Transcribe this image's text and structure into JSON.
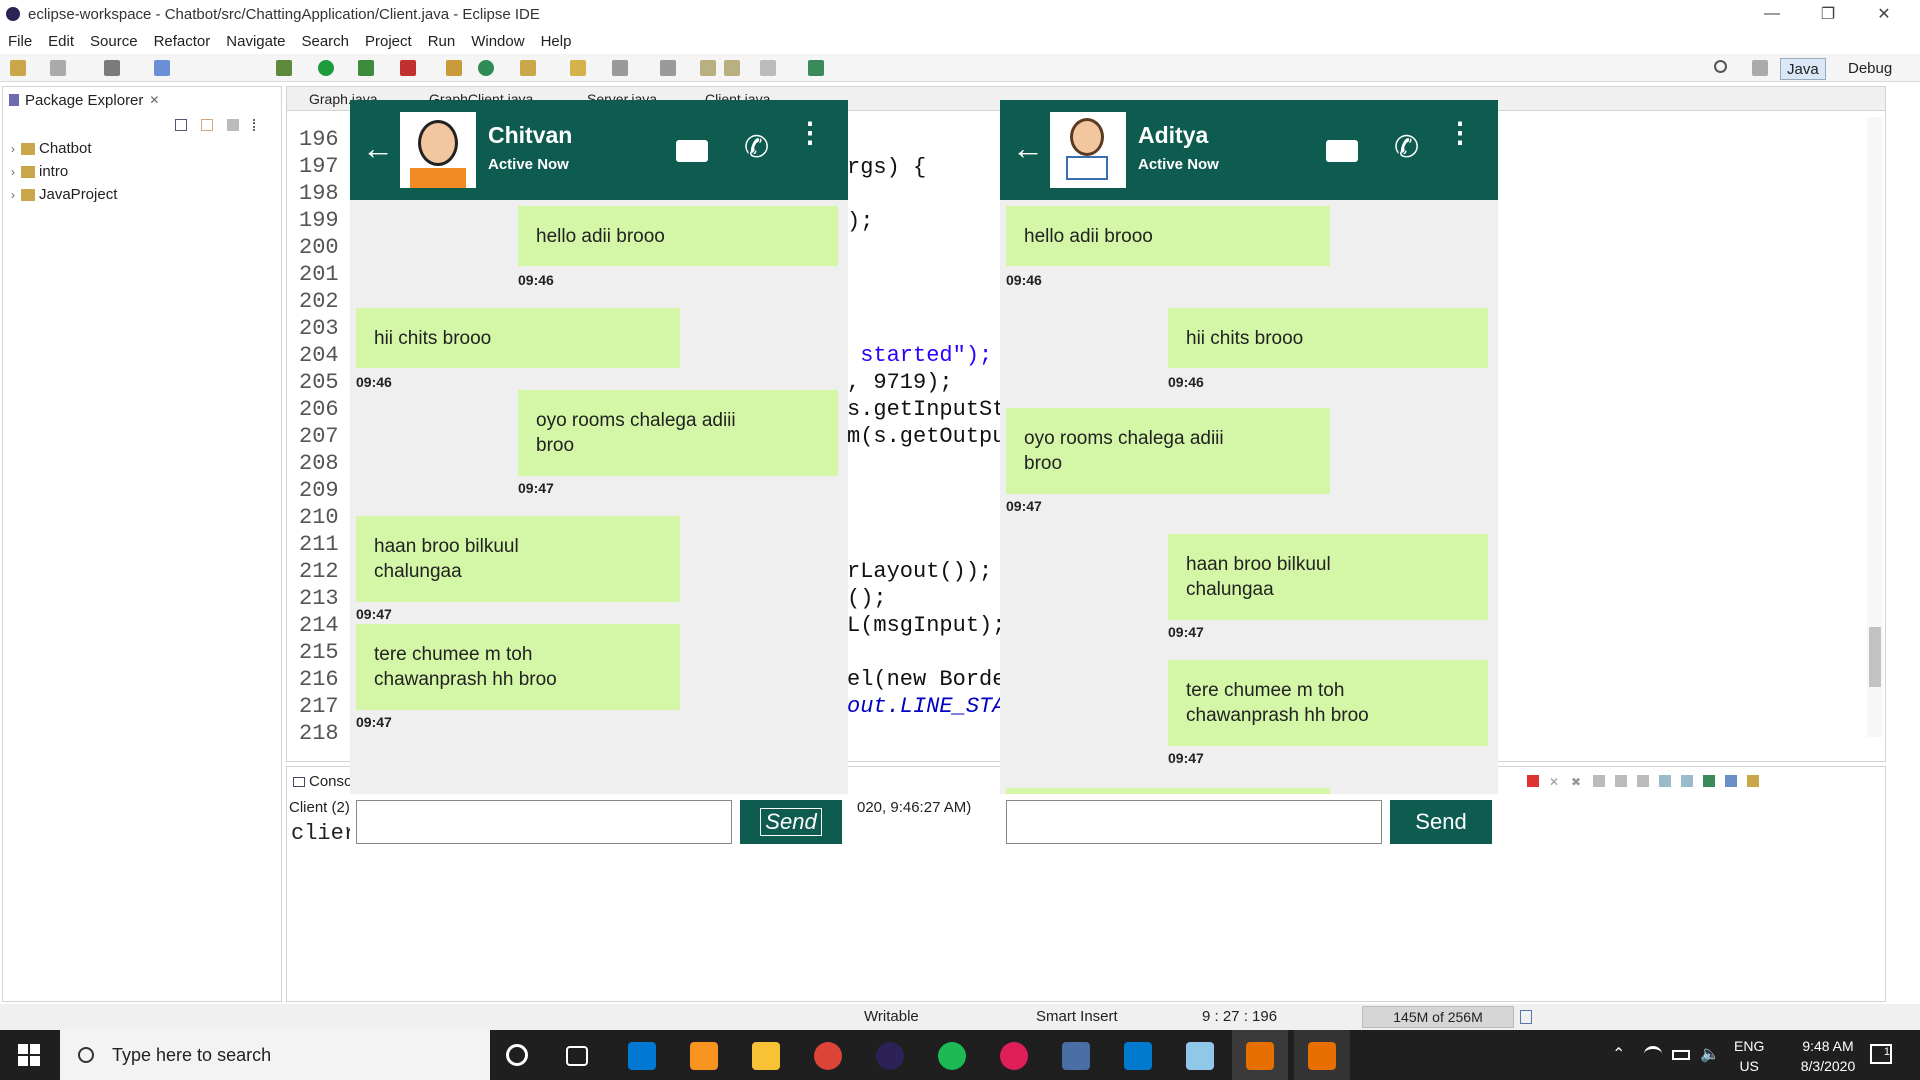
{
  "window": {
    "title": "eclipse-workspace - Chatbot/src/ChattingApplication/Client.java - Eclipse IDE"
  },
  "menu": [
    "File",
    "Edit",
    "Source",
    "Refactor",
    "Navigate",
    "Search",
    "Project",
    "Run",
    "Window",
    "Help"
  ],
  "perspectives": {
    "java": "Java",
    "debug": "Debug"
  },
  "package_explorer": {
    "title": "Package Explorer",
    "items": [
      "Chatbot",
      "intro",
      "JavaProject"
    ]
  },
  "editor": {
    "tabs": [
      "Graph.java",
      "GraphClient.java",
      "Server.java",
      "Client.java"
    ],
    "line_numbers": [
      "196",
      "197",
      "198",
      "199",
      "200",
      "201",
      "202",
      "203",
      "204",
      "205",
      "206",
      "207",
      "208",
      "209",
      "210",
      "211",
      "212",
      "213",
      "214",
      "215",
      "216",
      "217",
      "218"
    ],
    "code": {
      "l197": "rgs) {",
      "l199": ");",
      "l204": " started\");",
      "l205": ", 9719);",
      "l206": "s.getInputSt",
      "l207": "m(s.getOutpu",
      "l212": "rLayout());",
      "l213": "();",
      "l214": "L(msgInput);",
      "l216": "el(new Borde",
      "l217": "out.LINE_STA"
    }
  },
  "console": {
    "title": "Conso",
    "label": "Client (2)",
    "output": "clier",
    "timestamp": "020, 9:46:27 AM)"
  },
  "status": {
    "writable": "Writable",
    "insert": "Smart Insert",
    "position": "9 : 27 : 196",
    "memory": "145M of 256M"
  },
  "taskbar": {
    "search_placeholder": "Type here to search",
    "lang": "ENG",
    "region": "US",
    "time": "9:48 AM",
    "date": "8/3/2020",
    "notifications": "1"
  },
  "chat_left": {
    "name": "Chitvan",
    "status": "Active Now",
    "send_label": "Send",
    "messages": [
      {
        "text": "hello adii brooo",
        "time": "09:46"
      },
      {
        "text": "hii chits brooo",
        "time": "09:46"
      },
      {
        "text": "oyo rooms chalega adiii broo",
        "time": "09:47"
      },
      {
        "text": "haan broo bilkuul chalungaa",
        "time": "09:47"
      },
      {
        "text": "tere chumee m toh chawanprash hh broo",
        "time": "09:47"
      }
    ]
  },
  "chat_right": {
    "name": "Aditya",
    "status": "Active Now",
    "send_label": "Send",
    "messages": [
      {
        "text": "hello adii brooo",
        "time": "09:46"
      },
      {
        "text": "hii chits brooo",
        "time": "09:46"
      },
      {
        "text": "oyo rooms chalega adiii broo",
        "time": "09:47"
      },
      {
        "text": "haan broo bilkuul chalungaa",
        "time": "09:47"
      },
      {
        "text": "tere chumee m toh chawanprash hh broo",
        "time": "09:47"
      }
    ]
  },
  "colors": {
    "chat_header": "#0e5b50",
    "bubble": "#d3f7a6"
  }
}
